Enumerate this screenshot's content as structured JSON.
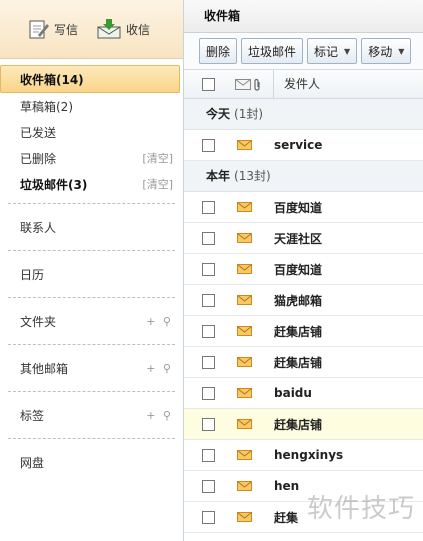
{
  "sidebar": {
    "write_label": "写信",
    "receive_label": "收信",
    "folders": [
      {
        "label": "收件箱(14)",
        "clear": ""
      },
      {
        "label": "草稿箱(2)",
        "clear": ""
      },
      {
        "label": "已发送",
        "clear": ""
      },
      {
        "label": "已删除",
        "clear": "[清空]"
      },
      {
        "label": "垃圾邮件(3)",
        "clear": "[清空]"
      }
    ],
    "contacts": "联系人",
    "calendar": "日历",
    "groups": [
      {
        "label": "文件夹",
        "actions": "+ ⚲"
      },
      {
        "label": "其他邮箱",
        "actions": "+ ⚲"
      },
      {
        "label": "标签",
        "actions": "+ ⚲"
      }
    ],
    "netdisk": "网盘"
  },
  "main": {
    "title": "收件箱",
    "toolbar": {
      "delete": "删除",
      "spam": "垃圾邮件",
      "mark": "标记",
      "move": "移动"
    },
    "header": {
      "from": "发件人"
    },
    "sections": [
      {
        "label": "今天",
        "count": "(1封)"
      },
      {
        "label": "本年",
        "count": "(13封)"
      }
    ],
    "today": [
      {
        "sender": "service"
      }
    ],
    "year": [
      {
        "sender": "百度知道"
      },
      {
        "sender": "天涯社区"
      },
      {
        "sender": "百度知道"
      },
      {
        "sender": "猫虎邮箱"
      },
      {
        "sender": "赶集店铺"
      },
      {
        "sender": "赶集店铺"
      },
      {
        "sender": "baidu"
      },
      {
        "sender": "赶集店铺"
      },
      {
        "sender": "hengxinys"
      },
      {
        "sender": "hen"
      },
      {
        "sender": "赶集"
      }
    ]
  },
  "watermark": "软件技巧",
  "colors": {
    "accent": "#f9d489",
    "envelope": "#e9a93a"
  }
}
